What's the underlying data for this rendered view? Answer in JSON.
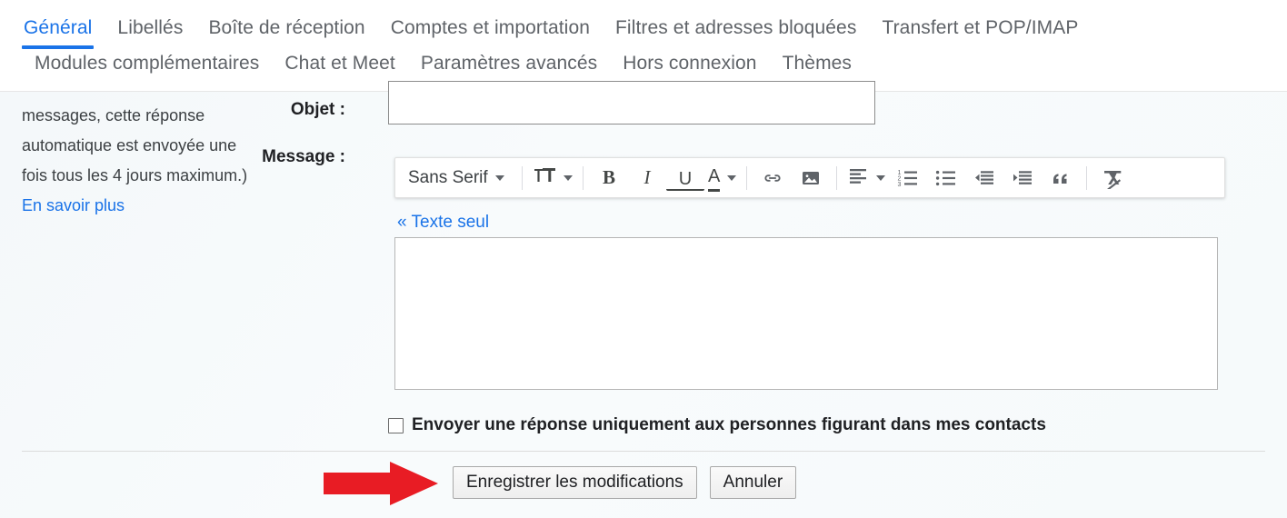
{
  "tabs": {
    "row1": [
      {
        "label": "Général",
        "active": true
      },
      {
        "label": "Libellés",
        "active": false
      },
      {
        "label": "Boîte de réception",
        "active": false
      },
      {
        "label": "Comptes et importation",
        "active": false
      },
      {
        "label": "Filtres et adresses bloquées",
        "active": false
      },
      {
        "label": "Transfert et POP/IMAP",
        "active": false
      }
    ],
    "row2": [
      {
        "label": "Modules complémentaires",
        "active": false
      },
      {
        "label": "Chat et Meet",
        "active": false
      },
      {
        "label": "Paramètres avancés",
        "active": false
      },
      {
        "label": "Hors connexion",
        "active": false
      },
      {
        "label": "Thèmes",
        "active": false
      }
    ]
  },
  "help": {
    "line1": "messages, cette réponse",
    "line2": "automatique est envoyée une",
    "line3": "fois tous les 4 jours maximum.)",
    "learn_more": "En savoir plus"
  },
  "form": {
    "subject_label": "Objet :",
    "subject_value": "",
    "subject_placeholder": "",
    "message_label": "Message :",
    "message_value": "",
    "message_placeholder": "",
    "plain_text_link": "« Texte seul",
    "checkbox_label": "Envoyer une réponse uniquement aux personnes figurant dans mes contacts",
    "checkbox_checked": false
  },
  "toolbar": {
    "font_name": "Sans Serif",
    "items": [
      {
        "name": "font-family-selector",
        "label": "Sans Serif"
      },
      {
        "name": "font-size-button",
        "label": "Taille de police"
      },
      {
        "name": "bold-button",
        "label": "B"
      },
      {
        "name": "italic-button",
        "label": "I"
      },
      {
        "name": "underline-button",
        "label": "U"
      },
      {
        "name": "text-color-button",
        "label": "A"
      },
      {
        "name": "insert-link-button",
        "label": "Insérer un lien"
      },
      {
        "name": "insert-image-button",
        "label": "Insérer une image"
      },
      {
        "name": "align-button",
        "label": "Alignement"
      },
      {
        "name": "numbered-list-button",
        "label": "Liste numérotée"
      },
      {
        "name": "bulleted-list-button",
        "label": "Liste à puces"
      },
      {
        "name": "indent-less-button",
        "label": "Diminuer le retrait"
      },
      {
        "name": "indent-more-button",
        "label": "Augmenter le retrait"
      },
      {
        "name": "quote-button",
        "label": "Citation"
      },
      {
        "name": "remove-formatting-button",
        "label": "Supprimer la mise en forme"
      }
    ]
  },
  "actions": {
    "save_label": "Enregistrer les modifications",
    "cancel_label": "Annuler"
  },
  "annotation": {
    "arrow_color": "#e81c24",
    "points_to": "Enregistrer les modifications"
  },
  "colors": {
    "accent": "#1a73e8",
    "text": "#202124",
    "muted": "#5f6368",
    "background": "#f7fafb"
  }
}
